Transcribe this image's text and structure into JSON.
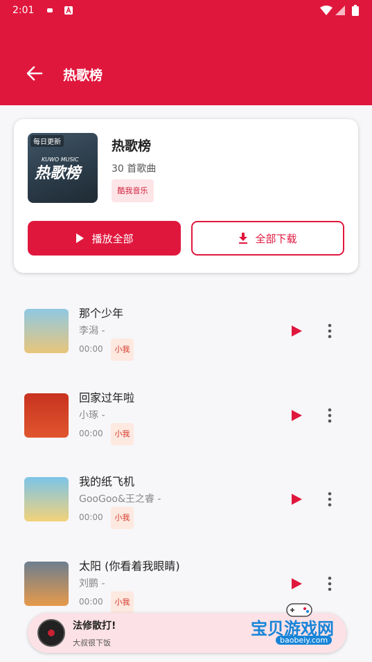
{
  "status": {
    "time": "2:01"
  },
  "header": {
    "title": "热歌榜"
  },
  "playlist": {
    "cover_badge": "每日更新",
    "cover_brand": "KUWO MUSIC",
    "cover_text": "热歌榜",
    "title": "热歌榜",
    "count": "30 首歌曲",
    "tag": "酷我音乐",
    "play_all": "播放全部",
    "download_all": "全部下载"
  },
  "songs": [
    {
      "title": "那个少年",
      "artist": "李潟 -",
      "duration": "00:00",
      "source": "小我",
      "thumb_colors": [
        "#8ec9e3",
        "#e9c57a"
      ]
    },
    {
      "title": "回家过年啦",
      "artist": "小琢 -",
      "duration": "00:00",
      "source": "小我",
      "thumb_colors": [
        "#c8321f",
        "#e0562e"
      ]
    },
    {
      "title": "我的纸飞机",
      "artist": "GooGoo&王之睿 -",
      "duration": "00:00",
      "source": "小我",
      "thumb_colors": [
        "#7bc4e8",
        "#f3d27a"
      ]
    },
    {
      "title": "太阳 (你看着我眼睛)",
      "artist": "刘鹏 -",
      "duration": "00:00",
      "source": "小我",
      "thumb_colors": [
        "#6d7e8f",
        "#e79a4a"
      ]
    }
  ],
  "mini_player": {
    "title": "法修散打!",
    "artist": "大叔很下饭"
  },
  "watermark": {
    "main": "宝贝游戏网",
    "sub": "baobeiy.com"
  },
  "colors": {
    "accent": "#e0173d"
  }
}
